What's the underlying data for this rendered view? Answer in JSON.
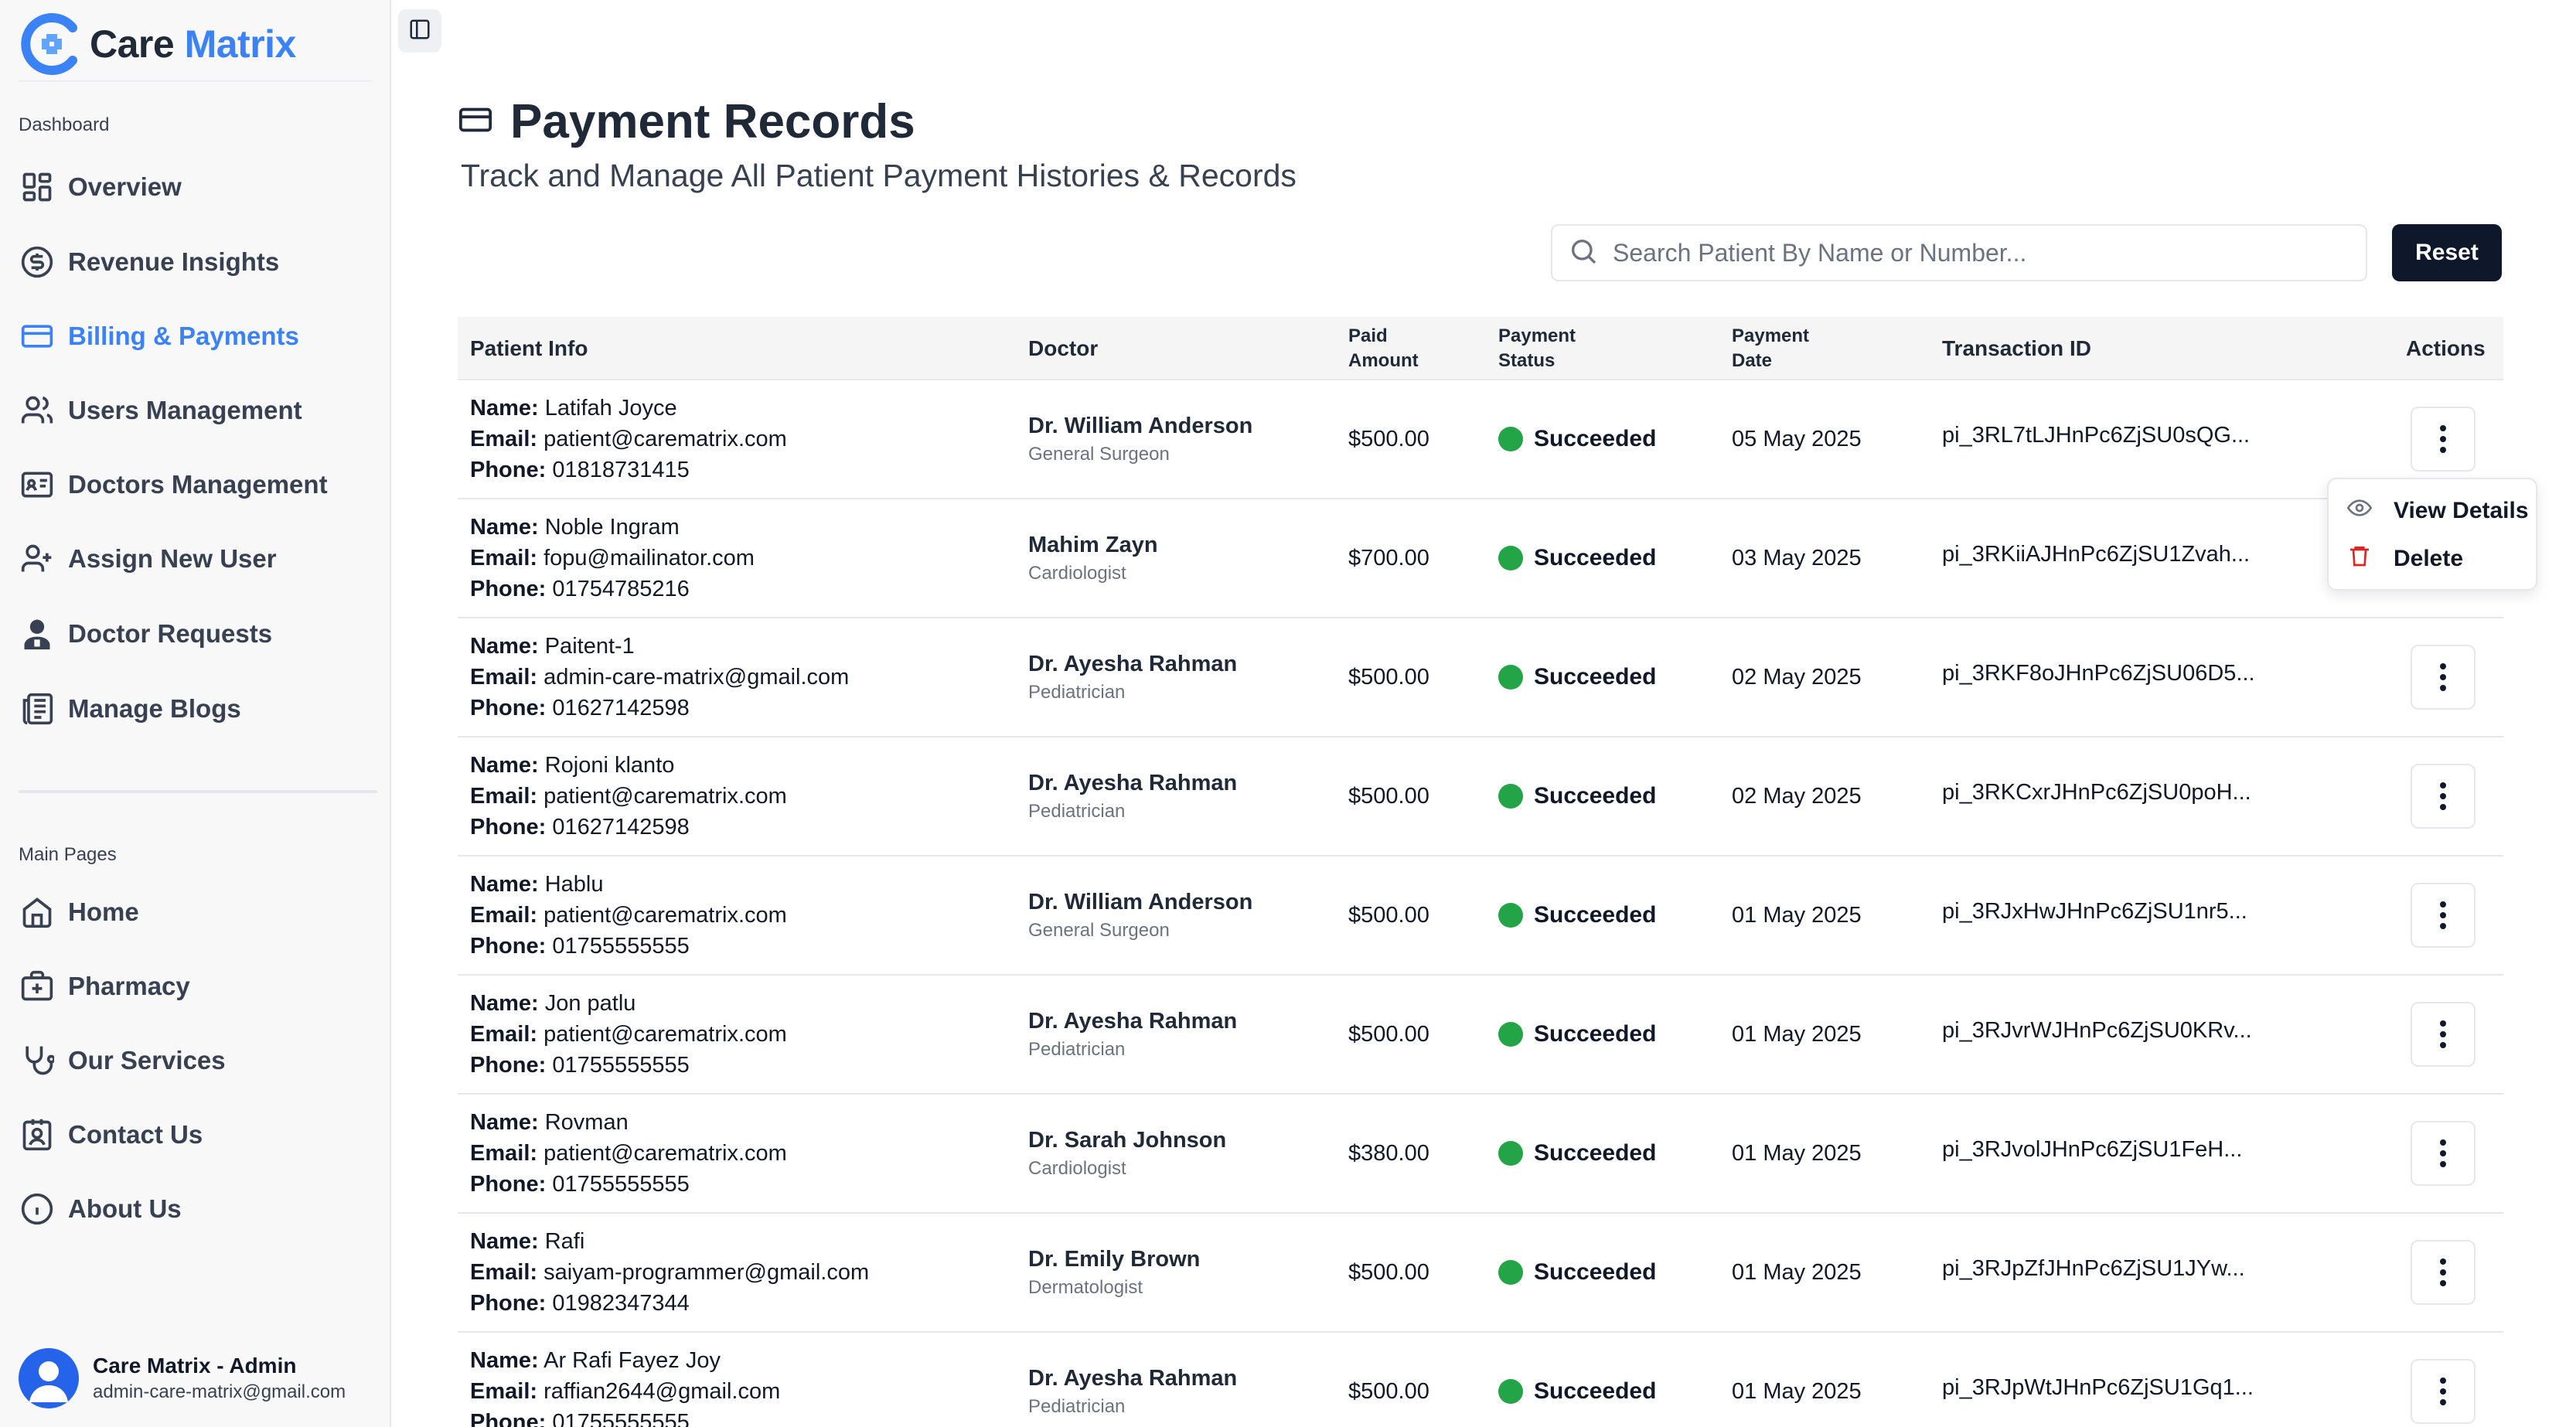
{
  "app": {
    "brand_care": "Care",
    "brand_matrix": "Matrix"
  },
  "sidebar": {
    "section1": "Dashboard",
    "items1": [
      {
        "label": "Overview",
        "icon": "grid-icon"
      },
      {
        "label": "Revenue Insights",
        "icon": "dollar-circle-icon"
      },
      {
        "label": "Billing & Payments",
        "icon": "credit-card-icon",
        "active": true
      },
      {
        "label": "Users Management",
        "icon": "users-icon"
      },
      {
        "label": "Doctors Management",
        "icon": "id-card-icon"
      },
      {
        "label": "Assign New User",
        "icon": "user-plus-icon"
      },
      {
        "label": "Doctor Requests",
        "icon": "doctor-icon"
      },
      {
        "label": "Manage Blogs",
        "icon": "newspaper-icon"
      }
    ],
    "section2": "Main Pages",
    "items2": [
      {
        "label": "Home",
        "icon": "home-icon"
      },
      {
        "label": "Pharmacy",
        "icon": "medical-bag-icon"
      },
      {
        "label": "Our Services",
        "icon": "stethoscope-icon"
      },
      {
        "label": "Contact Us",
        "icon": "contact-icon"
      },
      {
        "label": "About Us",
        "icon": "info-icon"
      }
    ],
    "user": {
      "name": "Care Matrix - Admin",
      "email": "admin-care-matrix@gmail.com"
    }
  },
  "header": {
    "title": "Payment Records",
    "subtitle": "Track and Manage All Patient Payment Histories & Records"
  },
  "search": {
    "placeholder": "Search Patient By Name or Number...",
    "reset_label": "Reset"
  },
  "table": {
    "headers": {
      "patient": "Patient Info",
      "doctor": "Doctor",
      "amount_l1": "Paid",
      "amount_l2": "Amount",
      "status_l1": "Payment",
      "status_l2": "Status",
      "date_l1": "Payment",
      "date_l2": "Date",
      "txn": "Transaction ID",
      "actions": "Actions"
    },
    "labels": {
      "name": "Name:",
      "email": "Email:",
      "phone": "Phone:"
    },
    "rows": [
      {
        "name": "Latifah Joyce",
        "email": "patient@carematrix.com",
        "phone": "01818731415",
        "doctor": "Dr. William Anderson",
        "spec": "General Surgeon",
        "amount": "$500.00",
        "status": "Succeeded",
        "date": "05 May 2025",
        "txn": "pi_3RL7tLJHnPc6ZjSU0sQG..."
      },
      {
        "name": "Noble Ingram",
        "email": "fopu@mailinator.com",
        "phone": "01754785216",
        "doctor": "Mahim Zayn",
        "spec": "Cardiologist",
        "amount": "$700.00",
        "status": "Succeeded",
        "date": "03 May 2025",
        "txn": "pi_3RKiiAJHnPc6ZjSU1Zvah..."
      },
      {
        "name": "Paitent-1",
        "email": "admin-care-matrix@gmail.com",
        "phone": "01627142598",
        "doctor": "Dr. Ayesha Rahman",
        "spec": "Pediatrician",
        "amount": "$500.00",
        "status": "Succeeded",
        "date": "02 May 2025",
        "txn": "pi_3RKF8oJHnPc6ZjSU06D5..."
      },
      {
        "name": "Rojoni klanto",
        "email": "patient@carematrix.com",
        "phone": "01627142598",
        "doctor": "Dr. Ayesha Rahman",
        "spec": "Pediatrician",
        "amount": "$500.00",
        "status": "Succeeded",
        "date": "02 May 2025",
        "txn": "pi_3RKCxrJHnPc6ZjSU0poH..."
      },
      {
        "name": "Hablu",
        "email": "patient@carematrix.com",
        "phone": "01755555555",
        "doctor": "Dr. William Anderson",
        "spec": "General Surgeon",
        "amount": "$500.00",
        "status": "Succeeded",
        "date": "01 May 2025",
        "txn": "pi_3RJxHwJHnPc6ZjSU1nr5..."
      },
      {
        "name": "Jon patlu",
        "email": "patient@carematrix.com",
        "phone": "01755555555",
        "doctor": "Dr. Ayesha Rahman",
        "spec": "Pediatrician",
        "amount": "$500.00",
        "status": "Succeeded",
        "date": "01 May 2025",
        "txn": "pi_3RJvrWJHnPc6ZjSU0KRv..."
      },
      {
        "name": "Rovman",
        "email": "patient@carematrix.com",
        "phone": "01755555555",
        "doctor": "Dr. Sarah Johnson",
        "spec": "Cardiologist",
        "amount": "$380.00",
        "status": "Succeeded",
        "date": "01 May 2025",
        "txn": "pi_3RJvolJHnPc6ZjSU1FeH..."
      },
      {
        "name": "Rafi",
        "email": "saiyam-programmer@gmail.com",
        "phone": "01982347344",
        "doctor": "Dr. Emily Brown",
        "spec": "Dermatologist",
        "amount": "$500.00",
        "status": "Succeeded",
        "date": "01 May 2025",
        "txn": "pi_3RJpZfJHnPc6ZjSU1JYw..."
      },
      {
        "name": "Ar Rafi Fayez Joy",
        "email": "raffian2644@gmail.com",
        "phone": "01755555555",
        "doctor": "Dr. Ayesha Rahman",
        "spec": "Pediatrician",
        "amount": "$500.00",
        "status": "Succeeded",
        "date": "01 May 2025",
        "txn": "pi_3RJpWtJHnPc6ZjSU1Gq1..."
      }
    ]
  },
  "dropdown": {
    "view": "View Details",
    "delete": "Delete"
  },
  "colors": {
    "accent": "#3b82f6",
    "success": "#22a447",
    "delete": "#dc2626",
    "dark_button": "#0f172a"
  }
}
